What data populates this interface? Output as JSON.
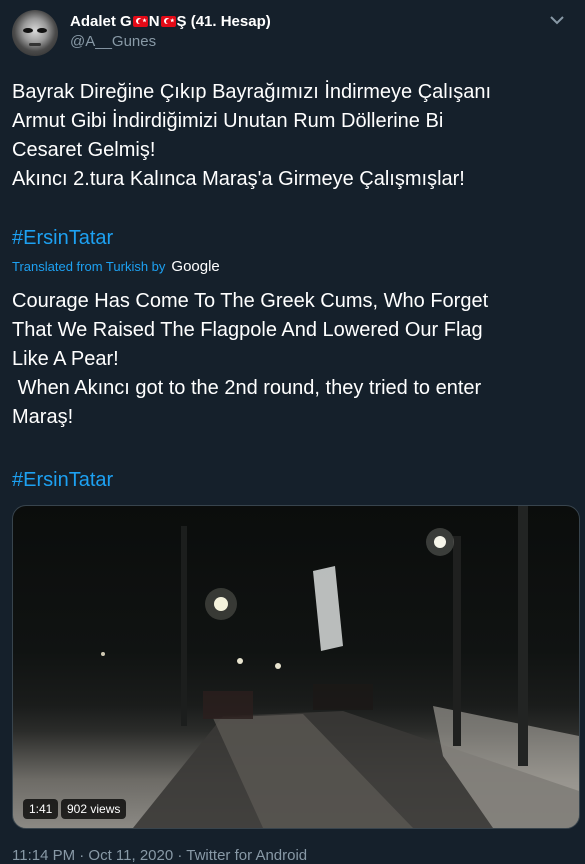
{
  "user": {
    "name_part1": "Adalet G",
    "name_part2": "N",
    "name_part3": "Ş (41. Hesap)",
    "handle": "@A__Gunes"
  },
  "tweet": {
    "text": "Bayrak Direğine Çıkıp Bayrağımızı İndirmeye Çalışanı\nArmut Gibi İndirdiğimizi Unutan Rum Döllerine Bi\nCesaret Gelmiş!\nAkıncı 2.tura Kalınca Maraş'a Girmeye Çalışmışlar!",
    "hashtag": "#ErsinTatar"
  },
  "translation": {
    "label": "Translated from Turkish by",
    "provider": "Google",
    "text": "Courage Has Come To The Greek Cums, Who Forget\nThat We Raised The Flagpole And Lowered Our Flag\nLike A Pear!\n When Akıncı got to the 2nd round, they tried to enter\nMaraş!",
    "hashtag": "#ErsinTatar"
  },
  "video": {
    "duration": "1:41",
    "views": "902 views"
  },
  "meta": {
    "footer": "11:14 PM · Oct 11, 2020 · Twitter for Android"
  },
  "colors": {
    "background": "#15202b",
    "link": "#1da1f2",
    "secondary_text": "#8899a6"
  }
}
